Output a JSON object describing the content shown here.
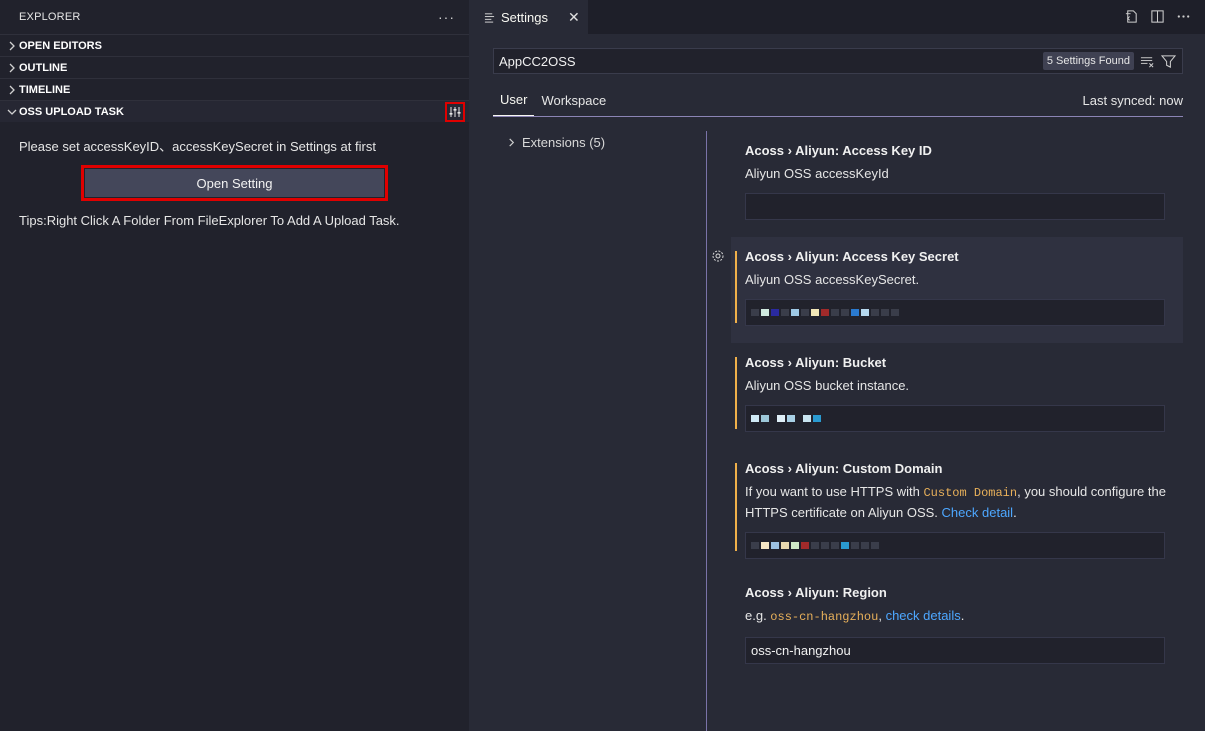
{
  "sidebar": {
    "title": "EXPLORER",
    "more_label": "···",
    "sections": [
      {
        "label": "OPEN EDITORS"
      },
      {
        "label": "OUTLINE"
      },
      {
        "label": "TIMELINE"
      }
    ],
    "oss": {
      "label": "OSS UPLOAD TASK",
      "message": "Please set accessKeyID、accessKeySecret in Settings at first",
      "button_label": "Open Setting",
      "tip": "Tips:Right Click A Folder From FileExplorer To Add A Upload Task."
    }
  },
  "editor": {
    "tab_label": "Settings",
    "tab_close": "✕",
    "search": {
      "value": "AppCC2OSS",
      "count_label": "5 Settings Found"
    },
    "scopes": {
      "user": "User",
      "workspace": "Workspace",
      "last_synced": "Last synced: now"
    },
    "toc": {
      "item_label": "Extensions (5)"
    },
    "settings": [
      {
        "category": "Acoss › Aliyun: ",
        "name": "Access Key ID",
        "desc": "Aliyun OSS accessKeyId",
        "value": ""
      },
      {
        "category": "Acoss › Aliyun: ",
        "name": "Access Key Secret",
        "desc": "Aliyun OSS accessKeySecret."
      },
      {
        "category": "Acoss › Aliyun: ",
        "name": "Bucket",
        "desc": "Aliyun OSS bucket instance."
      },
      {
        "category": "Acoss › Aliyun: ",
        "name": "Custom Domain",
        "desc_pre": "If you want to use HTTPS with ",
        "desc_code": "Custom Domain",
        "desc_mid": ", you should configure the HTTPS certificate on Aliyun OSS. ",
        "desc_link": "Check detail",
        "desc_post": "."
      },
      {
        "category": "Acoss › Aliyun: ",
        "name": "Region",
        "desc_pre": "e.g. ",
        "desc_code": "oss-cn-hangzhou",
        "desc_mid": ", ",
        "desc_link": "check details",
        "desc_post": ".",
        "value": "oss-cn-hangzhou"
      }
    ]
  },
  "colors": {
    "highlight_border": "#e00000",
    "modified_bar": "#f0b04a",
    "link": "#4da7ff",
    "code": "#e8b05a"
  }
}
